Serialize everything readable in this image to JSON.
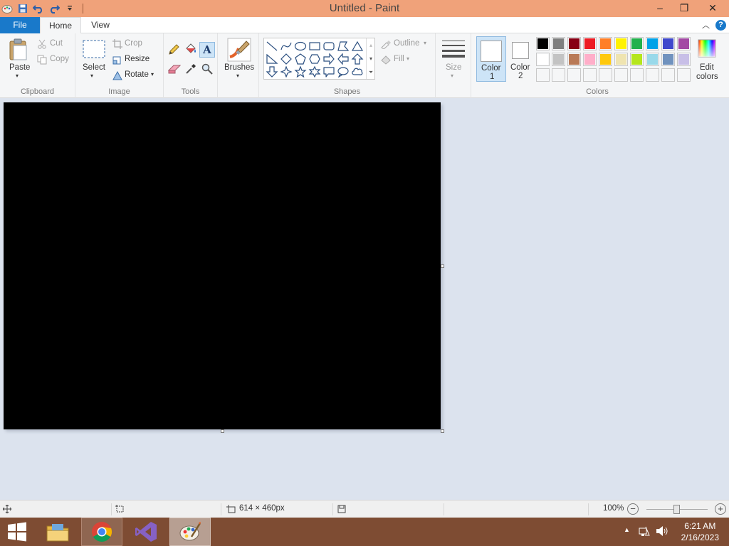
{
  "window": {
    "title": "Untitled - Paint",
    "controls": {
      "minimize": "–",
      "restore": "❐",
      "close": "✕"
    }
  },
  "tabs": {
    "file": "File",
    "home": "Home",
    "view": "View"
  },
  "help": {
    "collapse": "︿",
    "symbol": "?"
  },
  "clipboard": {
    "paste": "Paste",
    "cut": "Cut",
    "copy": "Copy",
    "group": "Clipboard"
  },
  "image": {
    "select": "Select",
    "crop": "Crop",
    "resize": "Resize",
    "rotate": "Rotate",
    "group": "Image"
  },
  "tools": {
    "group": "Tools",
    "text_glyph": "A"
  },
  "brushes": {
    "label": "Brushes"
  },
  "shapes": {
    "group": "Shapes",
    "outline": "Outline",
    "fill": "Fill"
  },
  "size": {
    "label": "Size"
  },
  "colors": {
    "color1_label_a": "Color",
    "color1_label_b": "1",
    "color2_label_a": "Color",
    "color2_label_b": "2",
    "edit_label_a": "Edit",
    "edit_label_b": "colors",
    "group": "Colors",
    "color1": "#ffffff",
    "color2": "#ffffff",
    "palette_row1": [
      "#000000",
      "#7f7f7f",
      "#880015",
      "#ed1c24",
      "#ff7f27",
      "#fff200",
      "#22b14c",
      "#00a2e8",
      "#3f48cc",
      "#a349a4"
    ],
    "palette_row2": [
      "#ffffff",
      "#c3c3c3",
      "#b97a57",
      "#ffaec9",
      "#ffc90e",
      "#efe4b0",
      "#b5e61d",
      "#99d9ea",
      "#7092be",
      "#c8bfe7"
    ]
  },
  "canvas": {
    "fill": "#000000"
  },
  "status": {
    "dimensions": "614 × 460px",
    "zoom": "100%",
    "zoom_out": "−",
    "zoom_in": "+"
  },
  "taskbar": {
    "apps": [
      "start",
      "file-explorer",
      "chrome",
      "visual-studio",
      "paint"
    ],
    "time": "6:21 AM",
    "date": "2/16/2023"
  }
}
